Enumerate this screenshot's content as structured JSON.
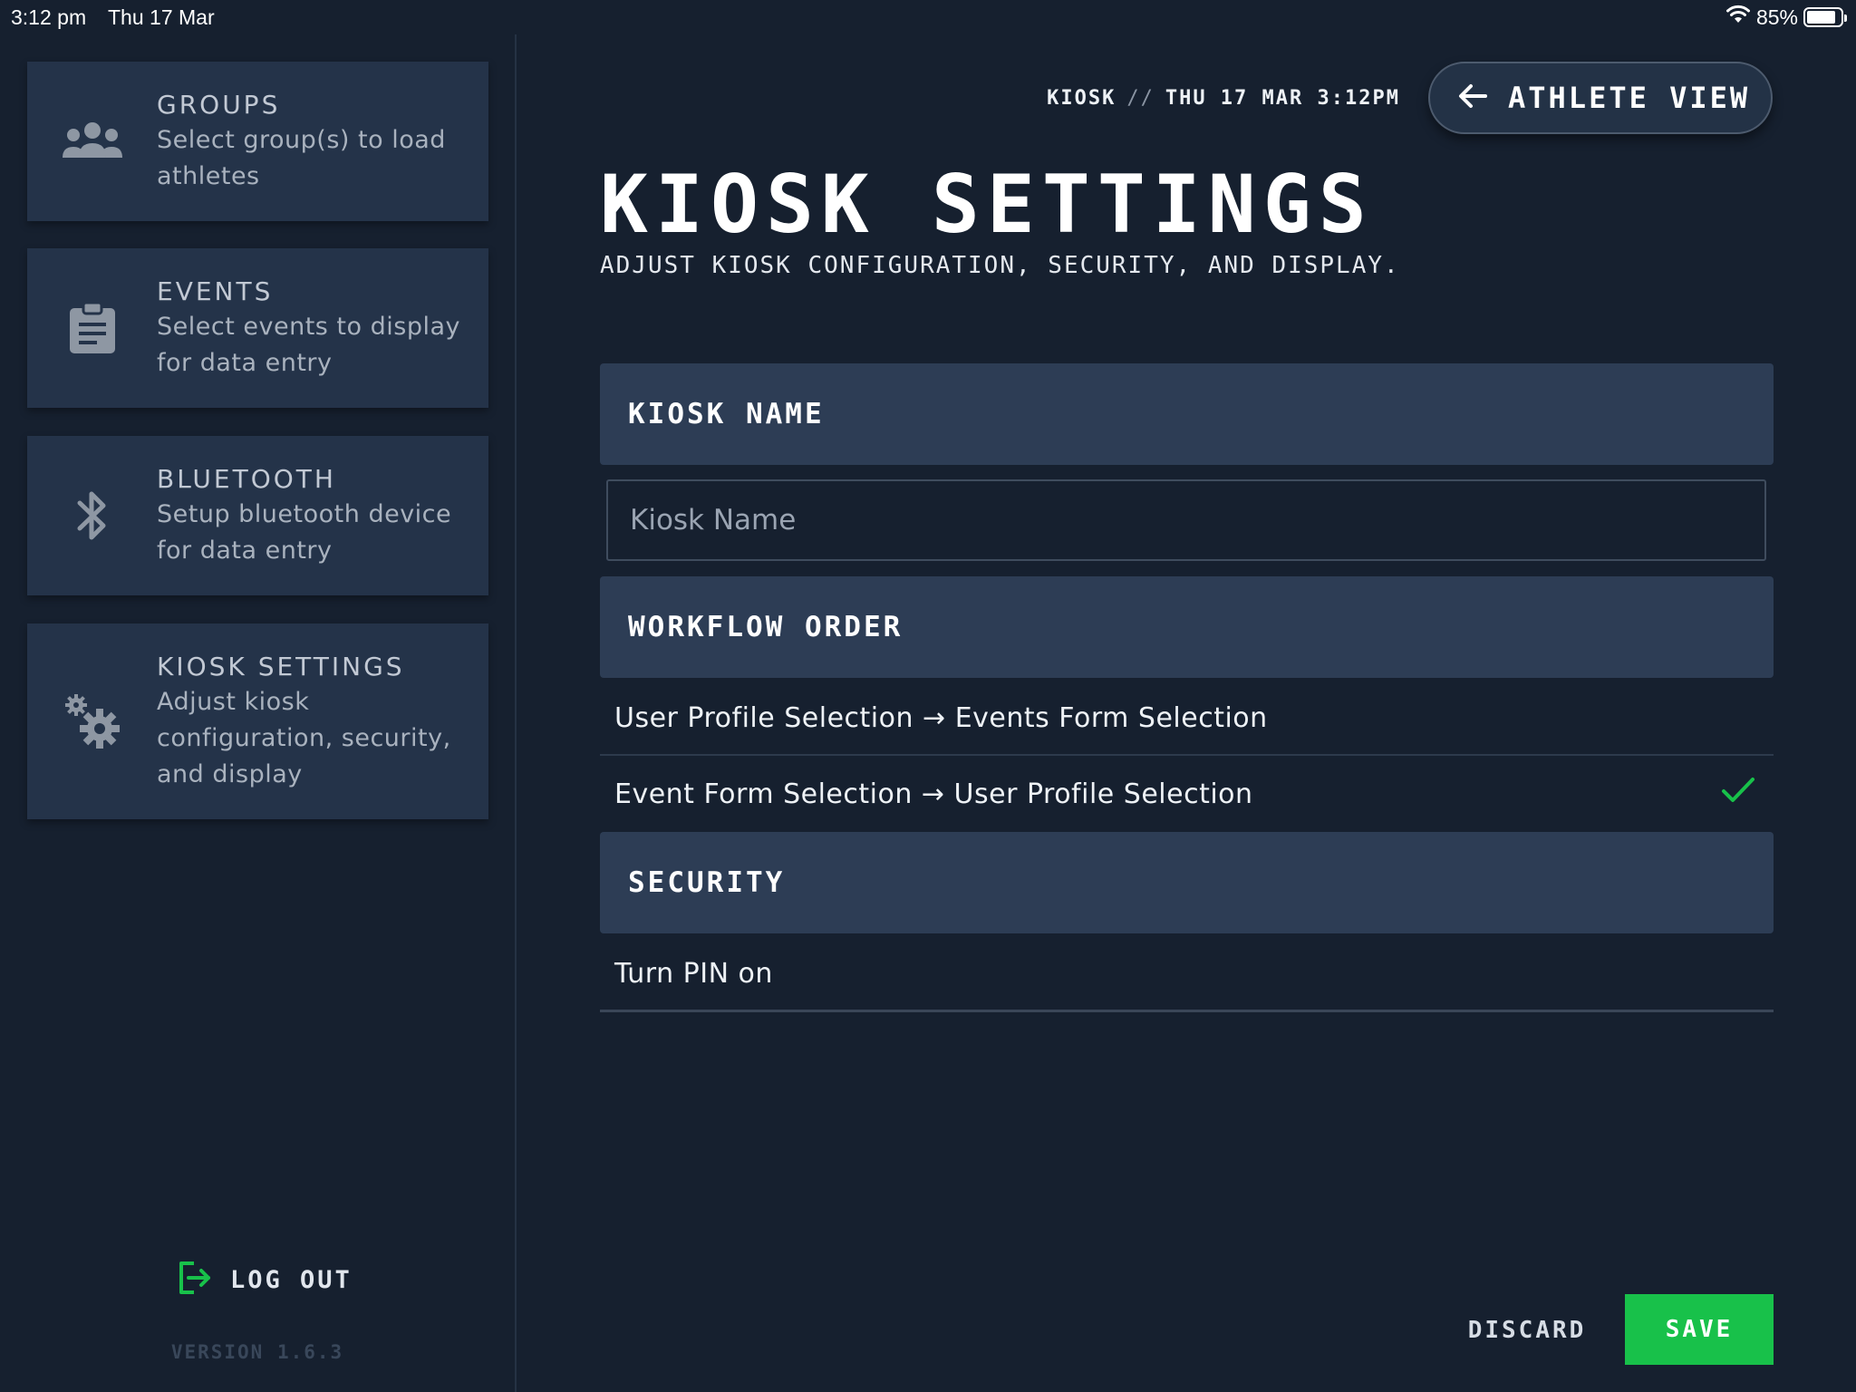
{
  "status_bar": {
    "time": "3:12 pm",
    "date": "Thu 17 Mar",
    "battery": "85%",
    "battery_level": 0.85
  },
  "sidebar": {
    "items": [
      {
        "title": "GROUPS",
        "description": "Select group(s) to load athletes",
        "icon": "people-icon"
      },
      {
        "title": "EVENTS",
        "description": "Select events to display for data entry",
        "icon": "clipboard-icon"
      },
      {
        "title": "BLUETOOTH",
        "description": "Setup bluetooth device for data entry",
        "icon": "bluetooth-icon"
      },
      {
        "title": "KIOSK SETTINGS",
        "description": "Adjust kiosk configuration, security, and display",
        "icon": "gears-icon"
      }
    ],
    "logout_label": "LOG OUT",
    "version": "VERSION 1.6.3"
  },
  "header": {
    "breadcrumb_kiosk": "KIOSK",
    "breadcrumb_sep": "//",
    "breadcrumb_datetime": "THU 17 MAR 3:12PM",
    "athlete_view_label": "ATHLETE VIEW"
  },
  "page": {
    "title": "KIOSK SETTINGS",
    "subtitle": "ADJUST KIOSK CONFIGURATION, SECURITY, AND DISPLAY."
  },
  "sections": {
    "kiosk_name": {
      "label": "KIOSK NAME",
      "input_value": "",
      "input_placeholder": "Kiosk Name"
    },
    "workflow_order": {
      "label": "WORKFLOW ORDER",
      "options": [
        {
          "label": "User Profile Selection → Events Form Selection",
          "selected": false
        },
        {
          "label": "Event Form Selection → User Profile Selection",
          "selected": true
        }
      ]
    },
    "security": {
      "label": "SECURITY",
      "options": [
        {
          "label": "Turn PIN on"
        }
      ]
    }
  },
  "footer": {
    "discard_label": "DISCARD",
    "save_label": "SAVE"
  },
  "colors": {
    "background": "#16202f",
    "card": "#243349",
    "section_header": "#2d3d55",
    "accent_green": "#18c14a"
  }
}
